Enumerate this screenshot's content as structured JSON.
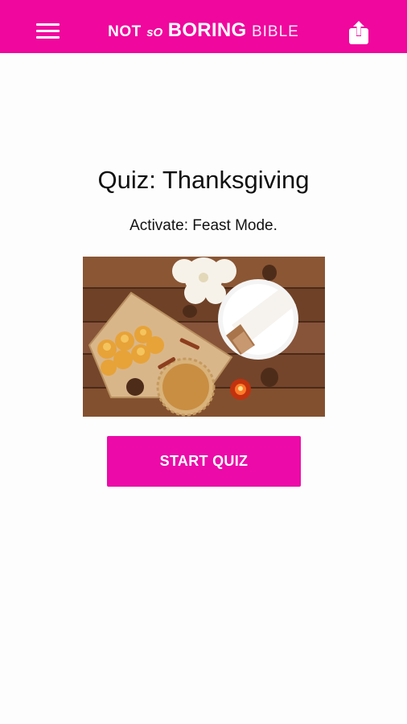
{
  "header": {
    "brand": {
      "part1": "NOT",
      "part2": "sO",
      "part3": "BORING",
      "part4": "BIBLE"
    },
    "menu_icon": "hamburger-menu-icon",
    "share_icon": "share-icon",
    "background_color": "#f0079d"
  },
  "quiz": {
    "title": "Quiz: Thanksgiving",
    "subtitle": "Activate: Feast Mode.",
    "image_description": "thanksgiving-table-photo",
    "start_label": "START QUIZ",
    "button_color": "#ec0aa8"
  }
}
